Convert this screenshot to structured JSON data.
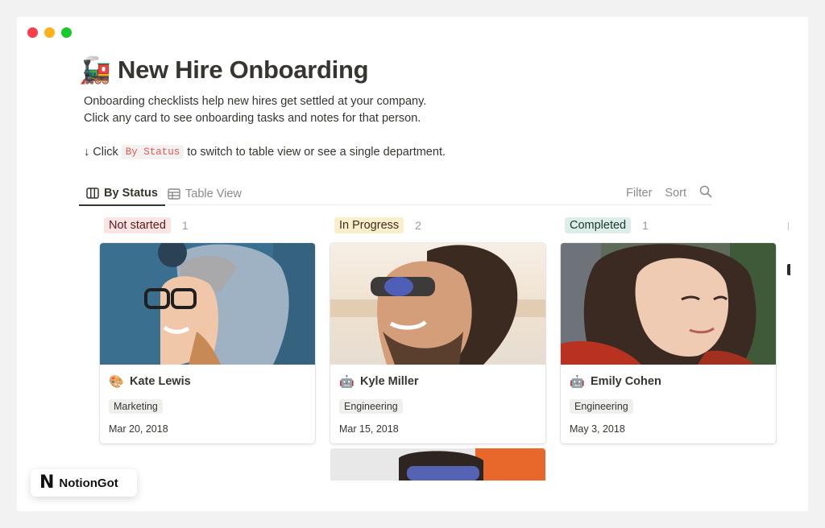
{
  "window": {
    "controls": [
      "close",
      "minimize",
      "maximize"
    ]
  },
  "page": {
    "icon": "🚂",
    "icon_name": "locomotive-icon",
    "title": "New Hire Onboarding",
    "description_lines": [
      "Onboarding checklists help new hires get settled at your company.",
      "Click any card to see onboarding tasks and notes for that person."
    ],
    "hint": {
      "prefix": "↓ Click",
      "code": "By Status",
      "suffix": "to switch to table view or see a single department."
    }
  },
  "views": {
    "tabs": [
      {
        "label": "By Status",
        "icon": "board-icon",
        "active": true
      },
      {
        "label": "Table View",
        "icon": "table-icon",
        "active": false
      }
    ],
    "actions": {
      "filter": "Filter",
      "sort": "Sort",
      "search_icon": "search-icon"
    }
  },
  "board": {
    "columns": [
      {
        "status": "Not started",
        "count": "1",
        "tag_bg": "#fbe4e4",
        "tag_color": "#5c1a1a",
        "cards": [
          {
            "name": "Kate Lewis",
            "icon": "🎨",
            "icon_name": "palette-icon",
            "department": "Marketing",
            "date": "Mar 20, 2018",
            "photo": "woman-in-grey-hood"
          }
        ]
      },
      {
        "status": "In Progress",
        "count": "2",
        "tag_bg": "#fbeecc",
        "tag_color": "#402c1b",
        "cards": [
          {
            "name": "Kyle Miller",
            "icon": "🤖",
            "icon_name": "robot-icon",
            "department": "Engineering",
            "date": "Mar 15, 2018",
            "photo": "man-with-sunglasses"
          },
          {
            "name": "",
            "photo": "man-with-blue-sunglasses",
            "partial": true
          }
        ]
      },
      {
        "status": "Completed",
        "count": "1",
        "tag_bg": "#ddedea",
        "tag_color": "#1c3829",
        "cards": [
          {
            "name": "Emily Cohen",
            "icon": "🤖",
            "icon_name": "robot-icon",
            "department": "Engineering",
            "date": "May 3, 2018",
            "photo": "woman-with-curly-hair"
          }
        ]
      }
    ]
  },
  "watermark": {
    "logo": "N",
    "name": "NotionGot"
  }
}
